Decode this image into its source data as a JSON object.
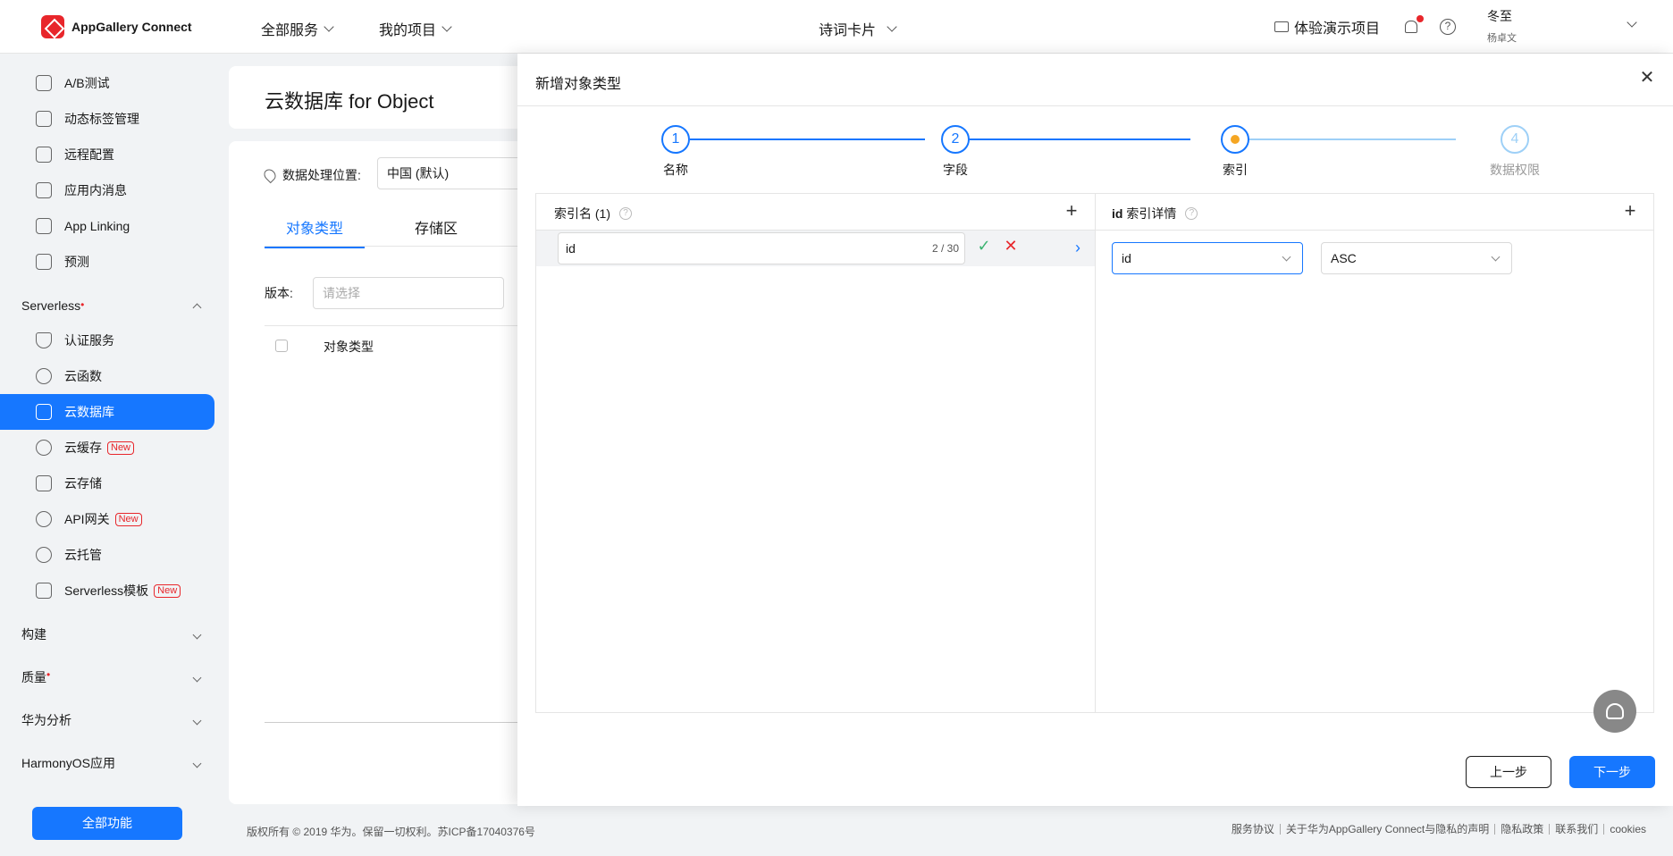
{
  "topbar": {
    "logo_text": "AppGallery Connect",
    "nav_all_services": "全部服务",
    "nav_my_projects": "我的项目",
    "project_name": "诗词卡片",
    "demo_project": "体验演示项目",
    "user_name": "冬至",
    "user_sub": "杨卓文"
  },
  "sidebar": {
    "items": [
      {
        "label": "A/B测试",
        "icon": "ab-test-icon"
      },
      {
        "label": "动态标签管理",
        "icon": "tag-manager-icon"
      },
      {
        "label": "远程配置",
        "icon": "remote-config-icon"
      },
      {
        "label": "应用内消息",
        "icon": "in-app-message-icon"
      },
      {
        "label": "App Linking",
        "icon": "app-linking-icon"
      },
      {
        "label": "预测",
        "icon": "prediction-icon"
      }
    ],
    "serverless_group": "Serverless",
    "serverless_items": [
      {
        "label": "认证服务",
        "icon": "auth-icon"
      },
      {
        "label": "云函数",
        "icon": "cloud-function-icon"
      },
      {
        "label": "云数据库",
        "icon": "cloud-db-icon"
      },
      {
        "label": "云缓存",
        "icon": "cloud-cache-icon",
        "badge": "New"
      },
      {
        "label": "云存储",
        "icon": "cloud-storage-icon"
      },
      {
        "label": "API网关",
        "icon": "api-gateway-icon",
        "badge": "New"
      },
      {
        "label": "云托管",
        "icon": "cloud-hosting-icon"
      },
      {
        "label": "Serverless模板",
        "icon": "serverless-template-icon",
        "badge": "New"
      }
    ],
    "groups": [
      "构建",
      "质量",
      "华为分析",
      "HarmonyOS应用"
    ],
    "all_functions": "全部功能"
  },
  "page": {
    "title": "云数据库 for Object",
    "location_label": "数据处理位置:",
    "location_value": "中国 (默认)",
    "tabs": [
      "对象类型",
      "存储区"
    ],
    "version_label": "版本:",
    "version_placeholder": "请选择",
    "column_object_type": "对象类型"
  },
  "drawer": {
    "title": "新增对象类型",
    "steps": [
      {
        "num": "1",
        "label": "名称"
      },
      {
        "num": "2",
        "label": "字段"
      },
      {
        "num": "",
        "label": "索引"
      },
      {
        "num": "4",
        "label": "数据权限"
      }
    ],
    "left_panel_title": "索引名 (1)",
    "index_name_value": "id",
    "index_name_count": "2 / 30",
    "right_panel_title_bold": "id",
    "right_panel_title": "索引详情",
    "field_select": "id",
    "order_select": "ASC",
    "prev_label": "上一步",
    "next_label": "下一步"
  },
  "footer": {
    "copyright": "版权所有 © 2019 华为。保留一切权利。苏ICP备17040376号",
    "links": [
      "服务协议",
      "关于华为AppGallery Connect与隐私的声明",
      "隐私政策",
      "联系我们",
      "cookies"
    ]
  },
  "colors": {
    "accent": "#1677ff",
    "current_step_dot": "#f5a623",
    "danger": "#e8262b"
  }
}
